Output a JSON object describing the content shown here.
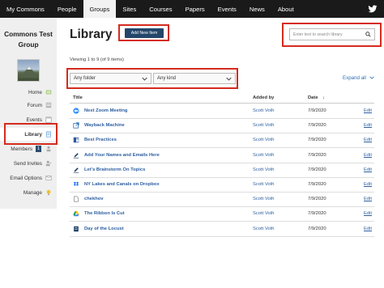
{
  "topnav": {
    "items": [
      "My Commons",
      "People",
      "Groups",
      "Sites",
      "Courses",
      "Papers",
      "Events",
      "News",
      "About"
    ],
    "active": "Groups",
    "twitter_icon": "twitter-icon"
  },
  "sidebar": {
    "group_name_line1": "Commons Test",
    "group_name_line2": "Group",
    "items": [
      {
        "label": "Home",
        "icon": "home-icon"
      },
      {
        "label": "Forum",
        "icon": "forum-icon"
      },
      {
        "label": "Events",
        "icon": "calendar-icon"
      },
      {
        "label": "Library",
        "icon": "document-icon",
        "active": true
      },
      {
        "label": "Members",
        "icon": "members-icon",
        "badge": "1"
      },
      {
        "label": "Send Invites",
        "icon": "invite-icon"
      },
      {
        "label": "Email Options",
        "icon": "email-icon"
      },
      {
        "label": "Manage",
        "icon": "lightbulb-icon"
      }
    ]
  },
  "main": {
    "title": "Library",
    "add_button": "Add New Item",
    "search_placeholder": "Enter text to search library",
    "viewing": "Viewing 1 to 9 (of 9 items)",
    "folder_filter": "Any folder",
    "kind_filter": "Any kind",
    "expand_all": "Expand all",
    "columns": {
      "title": "Title",
      "added_by": "Added by",
      "date": "Date",
      "sort_indicator": "↓"
    },
    "rows": [
      {
        "title": "Next Zoom Meeting",
        "added_by": "Scott Voth",
        "date": "7/9/2020",
        "action": "Edit",
        "icon": "zoom-icon"
      },
      {
        "title": "Wayback Machine",
        "added_by": "Scott Voth",
        "date": "7/9/2020",
        "action": "Edit",
        "icon": "external-link-icon"
      },
      {
        "title": "Best Practices",
        "added_by": "Scott Voth",
        "date": "7/9/2020",
        "action": "Edit",
        "icon": "word-doc-icon"
      },
      {
        "title": "Add Your Names and Emails Here",
        "added_by": "Scott Voth",
        "date": "7/9/2020",
        "action": "Edit",
        "icon": "pencil-icon"
      },
      {
        "title": "Let's Brainstorm On Topics",
        "added_by": "Scott Voth",
        "date": "7/9/2020",
        "action": "Edit",
        "icon": "pencil-icon"
      },
      {
        "title": "NY Lakes and Canals on Dropbox",
        "added_by": "Scott Voth",
        "date": "7/9/2020",
        "action": "Edit",
        "icon": "dropbox-icon"
      },
      {
        "title": "chekhov",
        "added_by": "Scott Voth",
        "date": "7/9/2020",
        "action": "Edit",
        "icon": "file-icon"
      },
      {
        "title": "The Ribbon Is Cut",
        "added_by": "Scott Voth",
        "date": "7/9/2020",
        "action": "Edit",
        "icon": "google-drive-icon"
      },
      {
        "title": "Day of the Locust",
        "added_by": "Scott Voth",
        "date": "7/9/2020",
        "action": "Edit",
        "icon": "pdf-icon"
      }
    ]
  },
  "colors": {
    "nav_bg": "#1a1a1a",
    "accent": "#24466a",
    "link": "#2d5fa0",
    "highlight": "#d52b1e",
    "sidebar_bg": "#efefef"
  }
}
